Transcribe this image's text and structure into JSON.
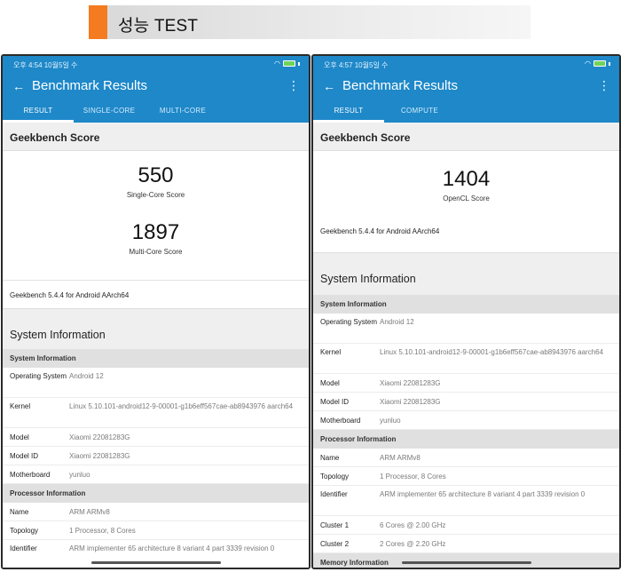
{
  "banner": {
    "title": "성능 TEST",
    "accent_color": "#f47b20"
  },
  "brand_color": "#1e88c9",
  "left": {
    "status_time": "오후 4:54 10월5일 수",
    "app_title": "Benchmark Results",
    "tabs": [
      "RESULT",
      "SINGLE-CORE",
      "MULTI-CORE"
    ],
    "score_title": "Geekbench Score",
    "scores": [
      {
        "value": "550",
        "label": "Single-Core Score"
      },
      {
        "value": "1897",
        "label": "Multi-Core Score"
      }
    ],
    "version": "Geekbench 5.4.4 for Android AArch64",
    "sys_title": "System Information",
    "groups": [
      {
        "title": "System Information",
        "rows": [
          {
            "label": "Operating System",
            "value": "Android 12"
          },
          {
            "label": "Kernel",
            "value": "Linux 5.10.101-android12-9-00001-g1b6eff567cae-ab8943976 aarch64"
          },
          {
            "label": "Model",
            "value": "Xiaomi 22081283G"
          },
          {
            "label": "Model ID",
            "value": "Xiaomi 22081283G"
          },
          {
            "label": "Motherboard",
            "value": "yunluo"
          }
        ]
      },
      {
        "title": "Processor Information",
        "rows": [
          {
            "label": "Name",
            "value": "ARM ARMv8"
          },
          {
            "label": "Topology",
            "value": "1 Processor, 8 Cores"
          },
          {
            "label": "Identifier",
            "value": "ARM implementer 65 architecture 8 variant 4 part 3339 revision 0"
          }
        ]
      }
    ]
  },
  "right": {
    "status_time": "오후 4:57 10월5일 수",
    "app_title": "Benchmark Results",
    "tabs": [
      "RESULT",
      "COMPUTE"
    ],
    "score_title": "Geekbench Score",
    "scores": [
      {
        "value": "1404",
        "label": "OpenCL Score"
      }
    ],
    "version": "Geekbench 5.4.4 for Android AArch64",
    "sys_title": "System Information",
    "groups": [
      {
        "title": "System Information",
        "rows": [
          {
            "label": "Operating System",
            "value": "Android 12"
          },
          {
            "label": "Kernel",
            "value": "Linux 5.10.101-android12-9-00001-g1b6eff567cae-ab8943976 aarch64"
          },
          {
            "label": "Model",
            "value": "Xiaomi 22081283G"
          },
          {
            "label": "Model ID",
            "value": "Xiaomi 22081283G"
          },
          {
            "label": "Motherboard",
            "value": "yunluo"
          }
        ]
      },
      {
        "title": "Processor Information",
        "rows": [
          {
            "label": "Name",
            "value": "ARM ARMv8"
          },
          {
            "label": "Topology",
            "value": "1 Processor, 8 Cores"
          },
          {
            "label": "Identifier",
            "value": "ARM implementer 65 architecture 8 variant 4 part 3339 revision 0"
          },
          {
            "label": "Cluster 1",
            "value": "6 Cores @ 2.00 GHz"
          },
          {
            "label": "Cluster 2",
            "value": "2 Cores @ 2.20 GHz"
          }
        ]
      },
      {
        "title": "Memory Information",
        "rows": []
      }
    ]
  }
}
